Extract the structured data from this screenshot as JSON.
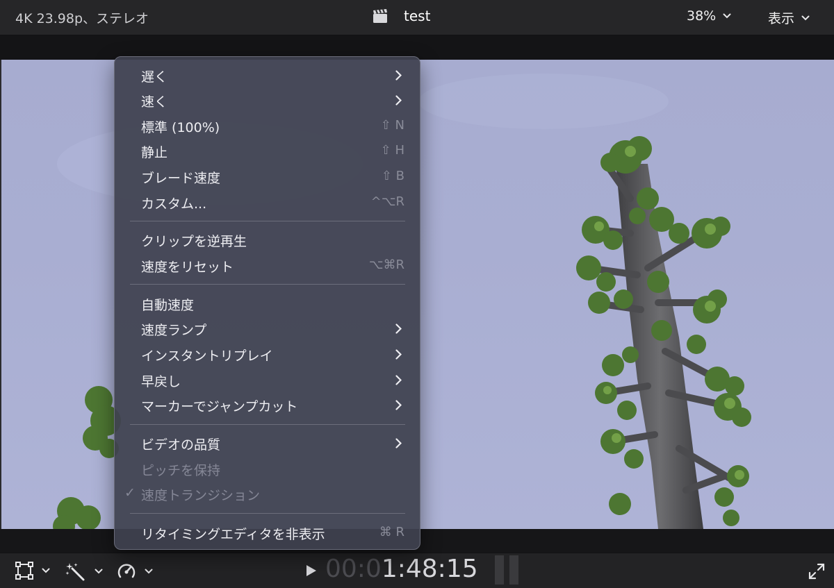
{
  "topbar": {
    "format": "4K 23.98p、ステレオ",
    "title": "test",
    "zoom": "38%",
    "view": "表示"
  },
  "timecode": {
    "dim": "00:0",
    "main": "1:48:15"
  },
  "menu": {
    "items": [
      {
        "label": "遅く",
        "shortcut": "",
        "submenu": true,
        "disabled": false,
        "checked": false
      },
      {
        "label": "速く",
        "shortcut": "",
        "submenu": true,
        "disabled": false,
        "checked": false
      },
      {
        "label": "標準 (100%)",
        "shortcut": "⇧ N",
        "submenu": false,
        "disabled": false,
        "checked": false
      },
      {
        "label": "静止",
        "shortcut": "⇧ H",
        "submenu": false,
        "disabled": false,
        "checked": false
      },
      {
        "label": "ブレード速度",
        "shortcut": "⇧ B",
        "submenu": false,
        "disabled": false,
        "checked": false
      },
      {
        "label": "カスタム...",
        "shortcut": "^⌥R",
        "submenu": false,
        "disabled": false,
        "checked": false
      },
      {
        "label": "クリップを逆再生",
        "shortcut": "",
        "submenu": false,
        "disabled": false,
        "checked": false
      },
      {
        "label": "速度をリセット",
        "shortcut": "⌥⌘R",
        "submenu": false,
        "disabled": false,
        "checked": false
      },
      {
        "label": "自動速度",
        "shortcut": "",
        "submenu": false,
        "disabled": false,
        "checked": false
      },
      {
        "label": "速度ランプ",
        "shortcut": "",
        "submenu": true,
        "disabled": false,
        "checked": false
      },
      {
        "label": "インスタントリプレイ",
        "shortcut": "",
        "submenu": true,
        "disabled": false,
        "checked": false
      },
      {
        "label": "早戻し",
        "shortcut": "",
        "submenu": true,
        "disabled": false,
        "checked": false
      },
      {
        "label": "マーカーでジャンプカット",
        "shortcut": "",
        "submenu": true,
        "disabled": false,
        "checked": false
      },
      {
        "label": "ビデオの品質",
        "shortcut": "",
        "submenu": true,
        "disabled": false,
        "checked": false
      },
      {
        "label": "ピッチを保持",
        "shortcut": "",
        "submenu": false,
        "disabled": true,
        "checked": false
      },
      {
        "label": "速度トランジション",
        "shortcut": "",
        "submenu": false,
        "disabled": true,
        "checked": true
      },
      {
        "label": "リタイミングエディタを非表示",
        "shortcut": "⌘ R",
        "submenu": false,
        "disabled": false,
        "checked": false
      }
    ],
    "check_mark": "✓"
  },
  "icons": {
    "clapper": "clapperboard-icon",
    "transform": "transform-icon",
    "enhance": "magic-wand-icon",
    "retime": "retime-speedometer-icon",
    "play": "play-icon",
    "fullscreen": "fullscreen-icon"
  },
  "colors": {
    "sky": "#a9aed2",
    "menu_bg": "#404250",
    "tree_green": "#4f7a34",
    "trunk": "#5a5a5c"
  }
}
